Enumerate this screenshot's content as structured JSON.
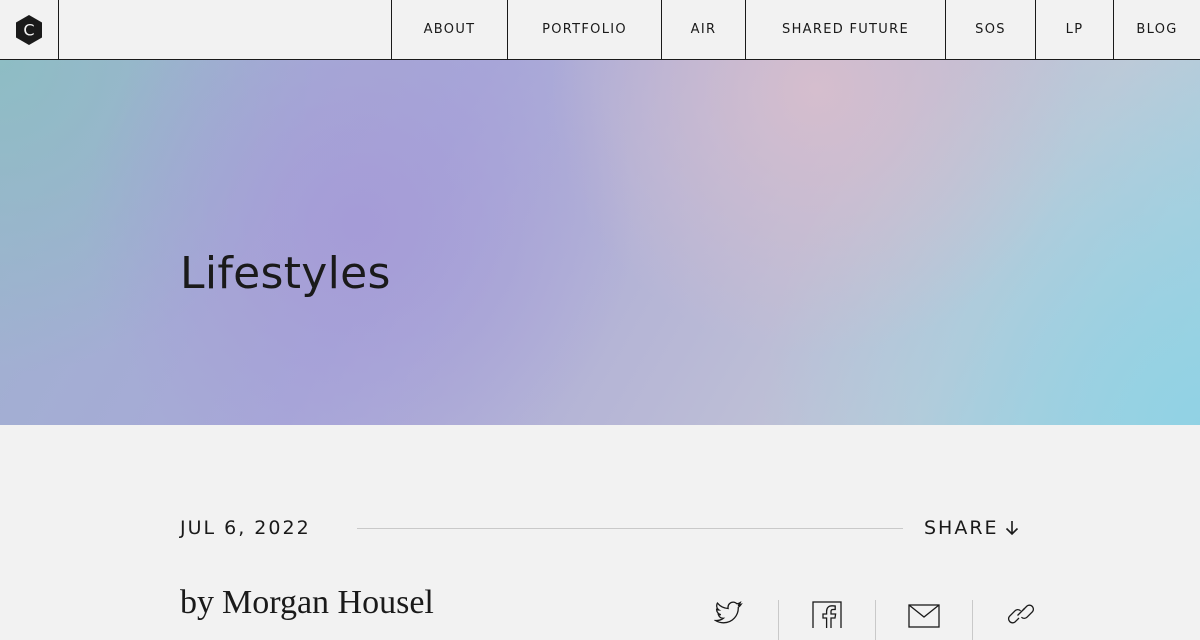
{
  "logo": {
    "letter": "C",
    "icon": "hexagon-c-logo-icon"
  },
  "nav": {
    "items": [
      {
        "label": "ABOUT"
      },
      {
        "label": "PORTFOLIO"
      },
      {
        "label": "AIR"
      },
      {
        "label": "SHARED FUTURE"
      },
      {
        "label": "SOS"
      },
      {
        "label": "LP"
      },
      {
        "label": "BLOG"
      }
    ]
  },
  "hero": {
    "title": "Lifestyles"
  },
  "meta": {
    "date": "JUL 6, 2022",
    "share_label": "SHARE",
    "share_icon": "arrow-down-icon"
  },
  "author": {
    "prefix": "by",
    "name": "Morgan Housel"
  },
  "social": {
    "icons": [
      "twitter-icon",
      "facebook-icon",
      "email-icon",
      "link-icon"
    ]
  },
  "colors": {
    "text": "#1a1a1a",
    "background": "#f2f2f2",
    "divider": "#c9c9c9"
  }
}
